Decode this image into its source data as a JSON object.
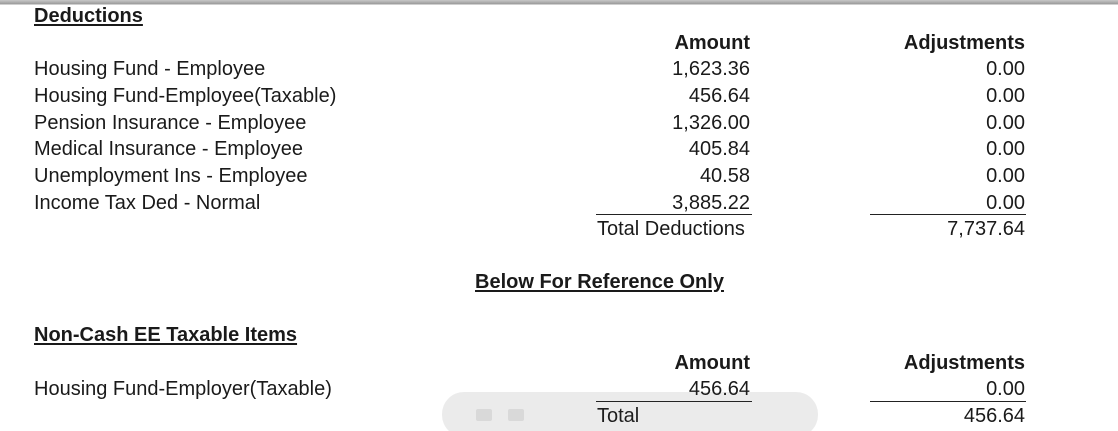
{
  "deductions": {
    "heading": "Deductions",
    "amount_header": "Amount",
    "adjustments_header": "Adjustments",
    "rows": [
      {
        "label": "Housing Fund - Employee",
        "amount": "1,623.36",
        "adjustment": "0.00"
      },
      {
        "label": "Housing Fund-Employee(Taxable)",
        "amount": "456.64",
        "adjustment": "0.00"
      },
      {
        "label": "Pension Insurance - Employee",
        "amount": "1,326.00",
        "adjustment": "0.00"
      },
      {
        "label": "Medical Insurance - Employee",
        "amount": "405.84",
        "adjustment": "0.00"
      },
      {
        "label": "Unemployment Ins - Employee",
        "amount": "40.58",
        "adjustment": "0.00"
      },
      {
        "label": "Income Tax Ded - Normal",
        "amount": "3,885.22",
        "adjustment": "0.00"
      }
    ],
    "total_label": "Total Deductions",
    "total_value": "7,737.64"
  },
  "reference_heading": "Below For Reference Only",
  "non_cash": {
    "heading": "Non-Cash EE Taxable Items",
    "amount_header": "Amount",
    "adjustments_header": "Adjustments",
    "rows": [
      {
        "label": "Housing Fund-Employer(Taxable)",
        "amount": "456.64",
        "adjustment": "0.00"
      }
    ],
    "total_label": "Total",
    "total_value": "456.64"
  }
}
